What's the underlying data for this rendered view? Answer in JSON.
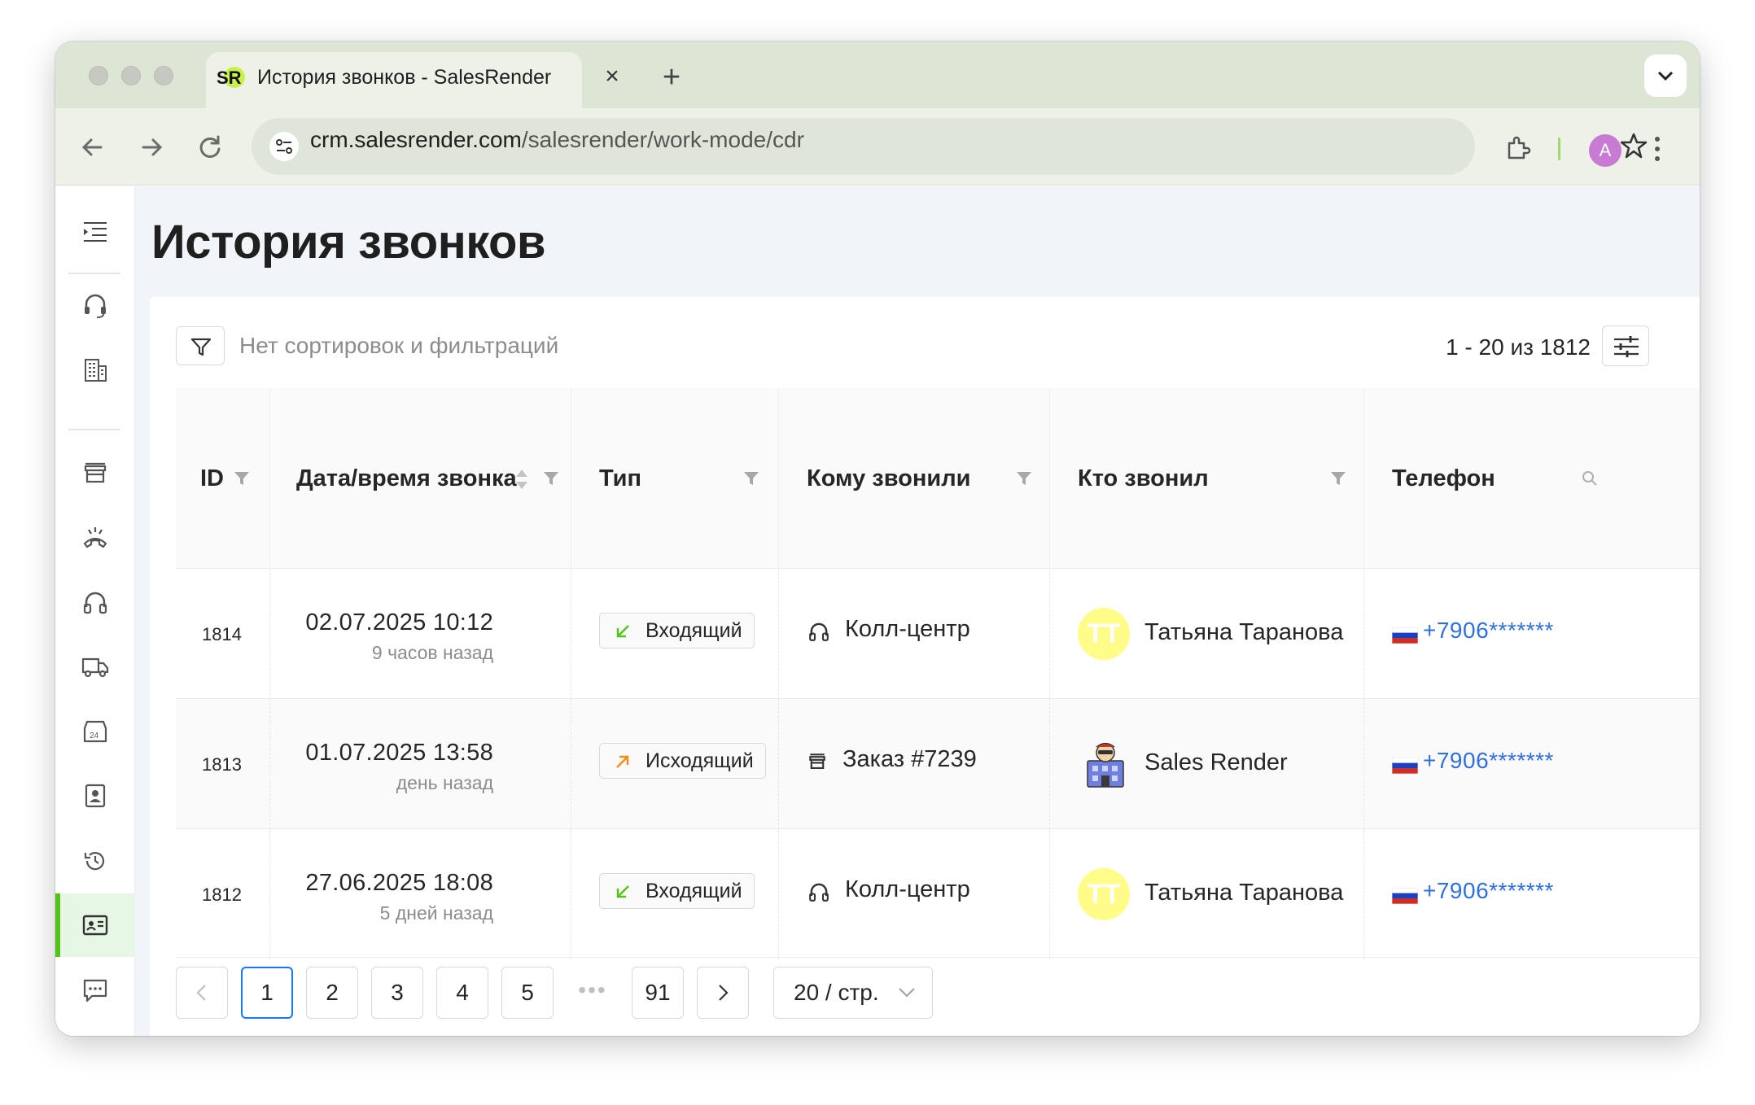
{
  "browser": {
    "tab_title": "История звонков - SalesRender",
    "favicon_text": "SR",
    "url_host": "crm.salesrender.com",
    "url_path": "/salesrender/work-mode/cdr",
    "profile_initial": "A"
  },
  "sidebar": {
    "items": [
      {
        "icon": "menu-collapse-icon"
      },
      {
        "icon": "headset-icon"
      },
      {
        "icon": "building-icon"
      },
      {
        "icon": "store-icon"
      },
      {
        "icon": "call-end-icon"
      },
      {
        "icon": "headphones-icon"
      },
      {
        "icon": "truck-icon"
      },
      {
        "icon": "store-24-icon"
      },
      {
        "icon": "contact-icon"
      },
      {
        "icon": "history-icon"
      },
      {
        "icon": "call-history-icon",
        "active": true
      },
      {
        "icon": "chat-icon"
      }
    ]
  },
  "page": {
    "title": "История звонков",
    "filter_text": "Нет сортировок и фильтраций",
    "range_text": "1 - 20 из 1812"
  },
  "table": {
    "columns": [
      "ID",
      "Дата/время звонка",
      "Тип",
      "Кому звонили",
      "Кто звонил",
      "Телефон"
    ],
    "rows": [
      {
        "id": "1814",
        "date": "02.07.2025 10:12",
        "ago": "9 часов назад",
        "type": "Входящий",
        "direction": "in",
        "target": "Колл-центр",
        "target_icon": "headphones-icon",
        "caller": "Татьяна Таранова",
        "caller_initials": "ТТ",
        "caller_kind": "user",
        "phone": "+7906*******"
      },
      {
        "id": "1813",
        "date": "01.07.2025 13:58",
        "ago": "день назад",
        "type": "Исходящий",
        "direction": "out",
        "target": "Заказ #7239",
        "target_icon": "store-icon",
        "caller": "Sales Render",
        "caller_initials": "",
        "caller_kind": "bot",
        "phone": "+7906*******"
      },
      {
        "id": "1812",
        "date": "27.06.2025 18:08",
        "ago": "5 дней назад",
        "type": "Входящий",
        "direction": "in",
        "target": "Колл-центр",
        "target_icon": "headphones-icon",
        "caller": "Татьяна Таранова",
        "caller_initials": "ТТ",
        "caller_kind": "user",
        "phone": "+7906*******"
      }
    ]
  },
  "pagination": {
    "pages": [
      "1",
      "2",
      "3",
      "4",
      "5"
    ],
    "last_page": "91",
    "current": "1",
    "ellipsis": "•••",
    "page_size": "20 / стр."
  },
  "colors": {
    "accent": "#52c41a",
    "link": "#2f6fe0",
    "active_page": "#1677ff",
    "avatar": "#fffc8a"
  }
}
